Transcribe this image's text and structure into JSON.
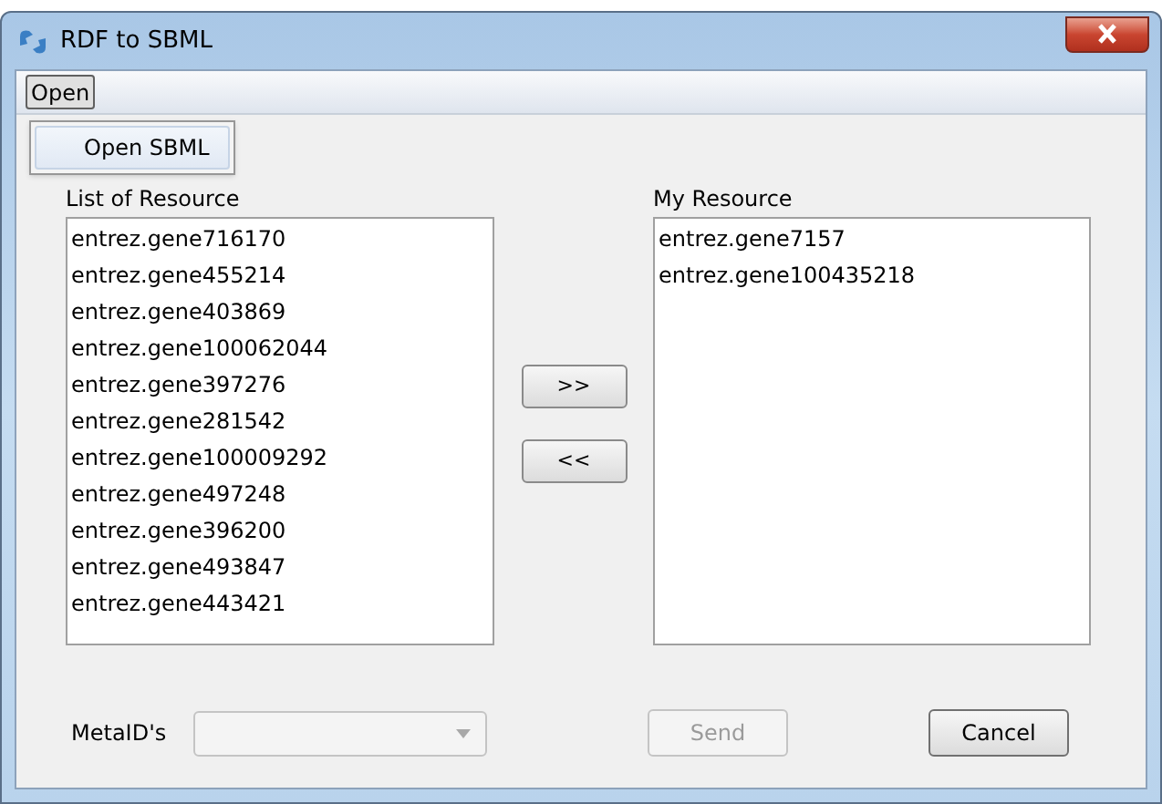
{
  "window": {
    "title": "RDF to SBML"
  },
  "menu": [
    {
      "label": "Open",
      "expanded": true,
      "items": [
        "Open SBML"
      ]
    }
  ],
  "left_list": {
    "label": "List of Resource",
    "items": [
      "entrez.gene716170",
      "entrez.gene455214",
      "entrez.gene403869",
      "entrez.gene100062044",
      "entrez.gene397276",
      "entrez.gene281542",
      "entrez.gene100009292",
      "entrez.gene497248",
      "entrez.gene396200",
      "entrez.gene493847",
      "entrez.gene443421"
    ]
  },
  "move_buttons": [
    {
      "label": ">>"
    },
    {
      "label": "<<"
    }
  ],
  "right_list": {
    "label": "My Resource",
    "items": [
      "entrez.gene7157",
      "entrez.gene100435218"
    ]
  },
  "metaid": {
    "label": "MetaID's",
    "disabled": true
  },
  "buttons": [
    {
      "label": "Send",
      "disabled": true
    },
    {
      "label": "Cancel",
      "disabled": false
    }
  ]
}
